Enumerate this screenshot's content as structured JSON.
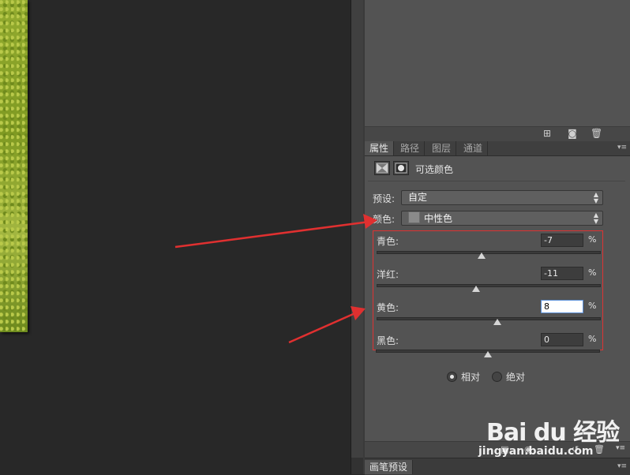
{
  "colors": {
    "panel_bg": "#535353",
    "canvas_bg": "#282828",
    "annotation_red": "#e03030",
    "focus_input_bg": "#ffffff"
  },
  "panel_tabs": [
    "属性",
    "路径",
    "图层",
    "通道"
  ],
  "active_tab": "属性",
  "panel_title": "可选颜色",
  "preset": {
    "label": "预设:",
    "value": "自定"
  },
  "colors_select": {
    "label": "颜色:",
    "value": "中性色"
  },
  "channels": [
    {
      "label": "青色:",
      "value": "-7",
      "unit": "%",
      "slider_fraction": 0.47
    },
    {
      "label": "洋红:",
      "value": "-11",
      "unit": "%",
      "slider_fraction": 0.445
    },
    {
      "label": "黄色:",
      "value": "8",
      "unit": "%",
      "slider_fraction": 0.54
    },
    {
      "label": "黑色:",
      "value": "0",
      "unit": "%",
      "slider_fraction": 0.5
    }
  ],
  "method": {
    "options": [
      "相对",
      "绝对"
    ],
    "selected": "相对"
  },
  "bottom_tab": "画笔预设",
  "watermark": {
    "logo": "Bai du 经验",
    "url": "jingyan.baidu.com"
  },
  "icons": {
    "top_footer": [
      "new-snapshot-icon",
      "camera-icon",
      "trash-icon"
    ],
    "header": [
      "adjustment-layer-icon",
      "mask-icon"
    ],
    "props_footer": [
      "clip-icon",
      "visibility-icon",
      "reset-icon",
      "trash-icon"
    ]
  }
}
